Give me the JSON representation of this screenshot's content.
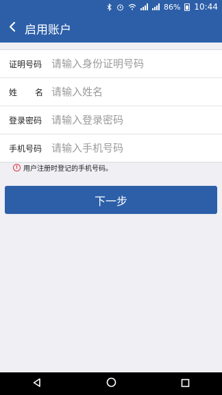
{
  "status_bar": {
    "battery": "86%",
    "time": "10:44"
  },
  "header": {
    "title": "启用账户",
    "back_icon": "chevron-left-icon"
  },
  "form": {
    "fields": [
      {
        "label": "证明号码",
        "placeholder": "请输入身份证明号码",
        "value": ""
      },
      {
        "label_chars": [
          "姓",
          "名"
        ],
        "placeholder": "请输入姓名",
        "value": ""
      },
      {
        "label": "登录密码",
        "placeholder": "请输入登录密码",
        "value": ""
      },
      {
        "label": "手机号码",
        "placeholder": "请输入手机号码",
        "value": ""
      }
    ]
  },
  "hint": {
    "text": "用户注册时登记的手机号码。",
    "icon": "info-icon",
    "icon_color": "#e2333b"
  },
  "actions": {
    "next_label": "下一步"
  },
  "theme": {
    "primary": "#2c5fa8",
    "background": "#efeff4"
  }
}
